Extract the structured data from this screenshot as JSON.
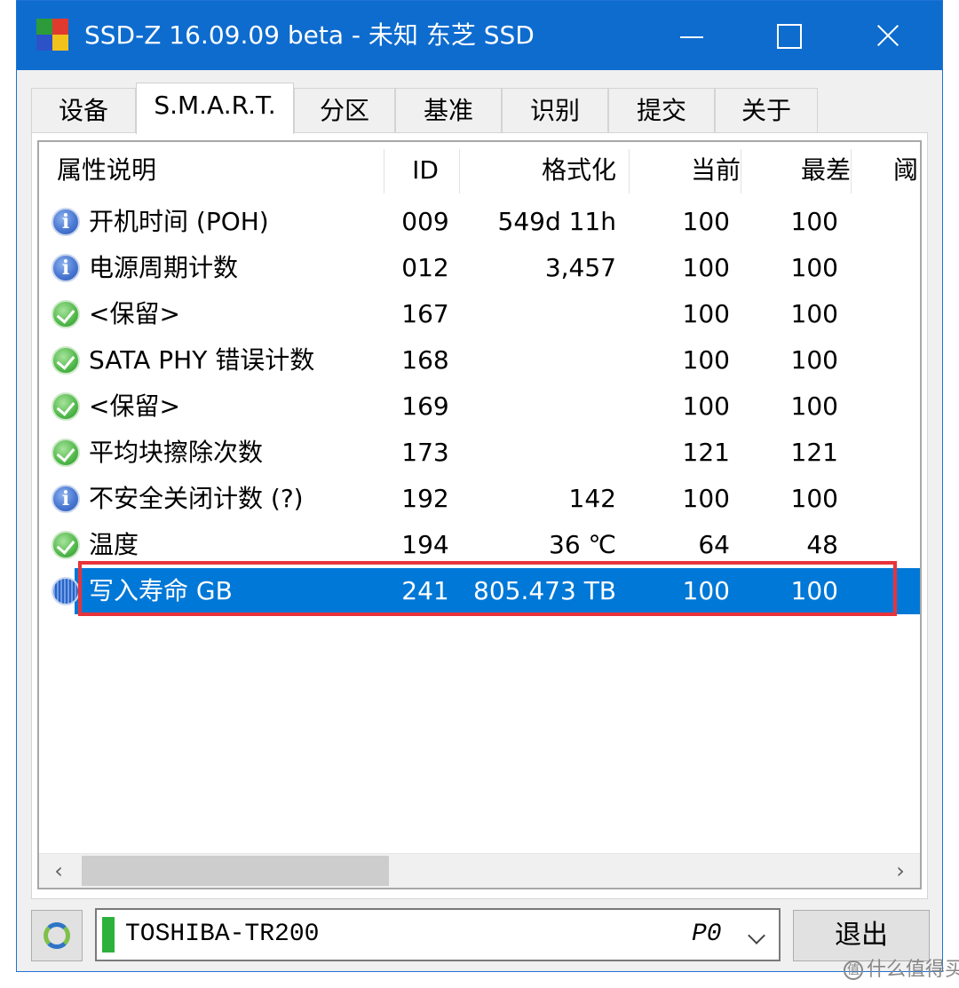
{
  "window": {
    "title": "SSD-Z 16.09.09 beta - 未知 东芝 SSD",
    "accent": "#0e6ccf"
  },
  "tabs": [
    {
      "label": "设备"
    },
    {
      "label": "S.M.A.R.T.",
      "active": true
    },
    {
      "label": "分区"
    },
    {
      "label": "基准"
    },
    {
      "label": "识别"
    },
    {
      "label": "提交"
    },
    {
      "label": "关于"
    }
  ],
  "table": {
    "headers": [
      "属性说明",
      "ID",
      "格式化",
      "当前",
      "最差",
      "阈"
    ],
    "rows": [
      {
        "status": "info-icon",
        "name": "开机时间 (POH)",
        "id": "009",
        "formatted": "549d 11h",
        "current": "100",
        "worst": "100"
      },
      {
        "status": "ok-icon",
        "name": "电源周期计数",
        "id": "012",
        "formatted": "3,457",
        "current": "100",
        "worst": "100",
        "status_override": "info-icon"
      },
      {
        "status": "ok-icon",
        "name": "<保留>",
        "id": "167",
        "formatted": "",
        "current": "100",
        "worst": "100"
      },
      {
        "status": "ok-icon",
        "name": "SATA PHY 错误计数",
        "id": "168",
        "formatted": "",
        "current": "100",
        "worst": "100"
      },
      {
        "status": "ok-icon",
        "name": "<保留>",
        "id": "169",
        "formatted": "",
        "current": "100",
        "worst": "100"
      },
      {
        "status": "ok-icon",
        "name": "平均块擦除次数",
        "id": "173",
        "formatted": "",
        "current": "121",
        "worst": "121"
      },
      {
        "status": "info-icon",
        "name": "不安全关闭计数 (?)",
        "id": "192",
        "formatted": "142",
        "current": "100",
        "worst": "100"
      },
      {
        "status": "ok-icon",
        "name": "温度",
        "id": "194",
        "formatted": "36 ℃",
        "current": "64",
        "worst": "48"
      },
      {
        "status": "info-icon",
        "name": "写入寿命 GB",
        "id": "241",
        "formatted": "805.473 TB",
        "current": "100",
        "worst": "100",
        "selected": true
      }
    ],
    "selection_color": "#0078d7",
    "highlight_frame_color": "#e8333a"
  },
  "bottom": {
    "drive_name": "TOSHIBA-TR200",
    "drive_port": "P0",
    "exit_label": "退出"
  },
  "watermark": {
    "text": "什么值得买",
    "icon_glyph": "值"
  }
}
